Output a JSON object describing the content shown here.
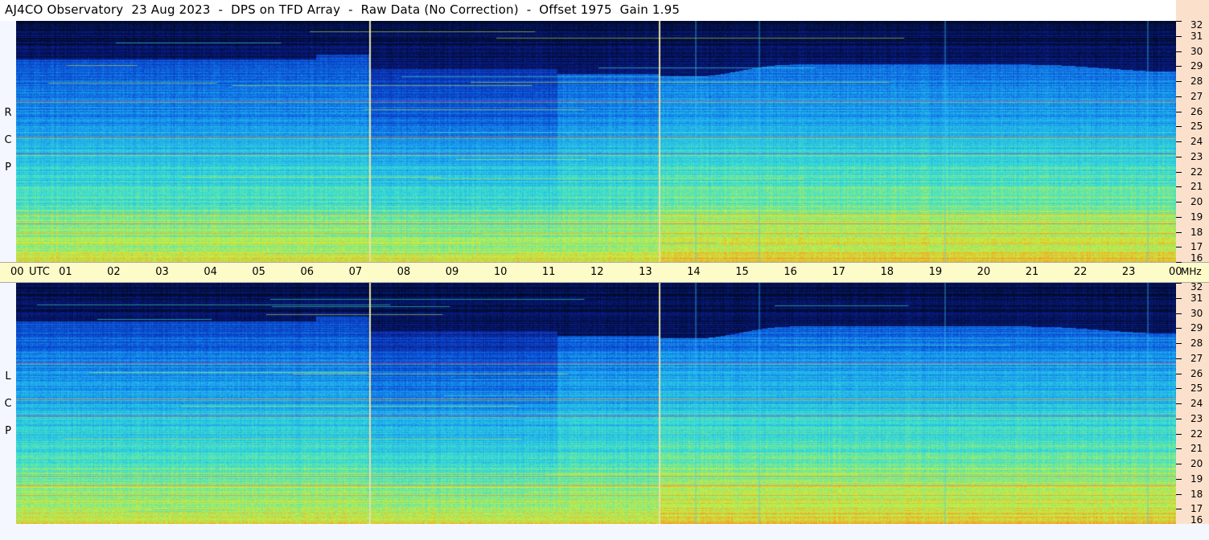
{
  "header": {
    "title": "AJ4CO Observatory  23 Aug 2023  -  DPS on TFD Array  -  Raw Data (No Correction)  -  Offset 1975  Gain 1.95"
  },
  "chart_data": {
    "type": "heatmap",
    "panels": [
      {
        "polarization_label": [
          "R",
          "C",
          "P"
        ]
      },
      {
        "polarization_label": [
          "L",
          "C",
          "P"
        ]
      }
    ],
    "x_axis": {
      "unit_label": "UTC",
      "range_hours": [
        0,
        24
      ],
      "tick_labels": [
        "00",
        "01",
        "02",
        "03",
        "04",
        "05",
        "06",
        "07",
        "08",
        "09",
        "10",
        "11",
        "12",
        "13",
        "14",
        "15",
        "16",
        "17",
        "18",
        "19",
        "20",
        "21",
        "22",
        "23",
        "00"
      ]
    },
    "y_axis": {
      "unit_label": "MHz",
      "range_mhz": [
        16,
        32
      ],
      "tick_labels": [
        "32",
        "31",
        "30",
        "29",
        "28",
        "27",
        "26",
        "25",
        "24",
        "23",
        "22",
        "21",
        "20",
        "19",
        "18",
        "17",
        "16"
      ]
    },
    "colormap": [
      "#000a28",
      "#0a1c8a",
      "#0a4fd6",
      "#1aa3f0",
      "#3ce0d0",
      "#c8f040",
      "#ff8a20",
      "#ff2a6a"
    ],
    "vertical_markers_utc_hours": [
      7.3,
      13.3
    ],
    "marker_color": "#e8e0a0"
  }
}
